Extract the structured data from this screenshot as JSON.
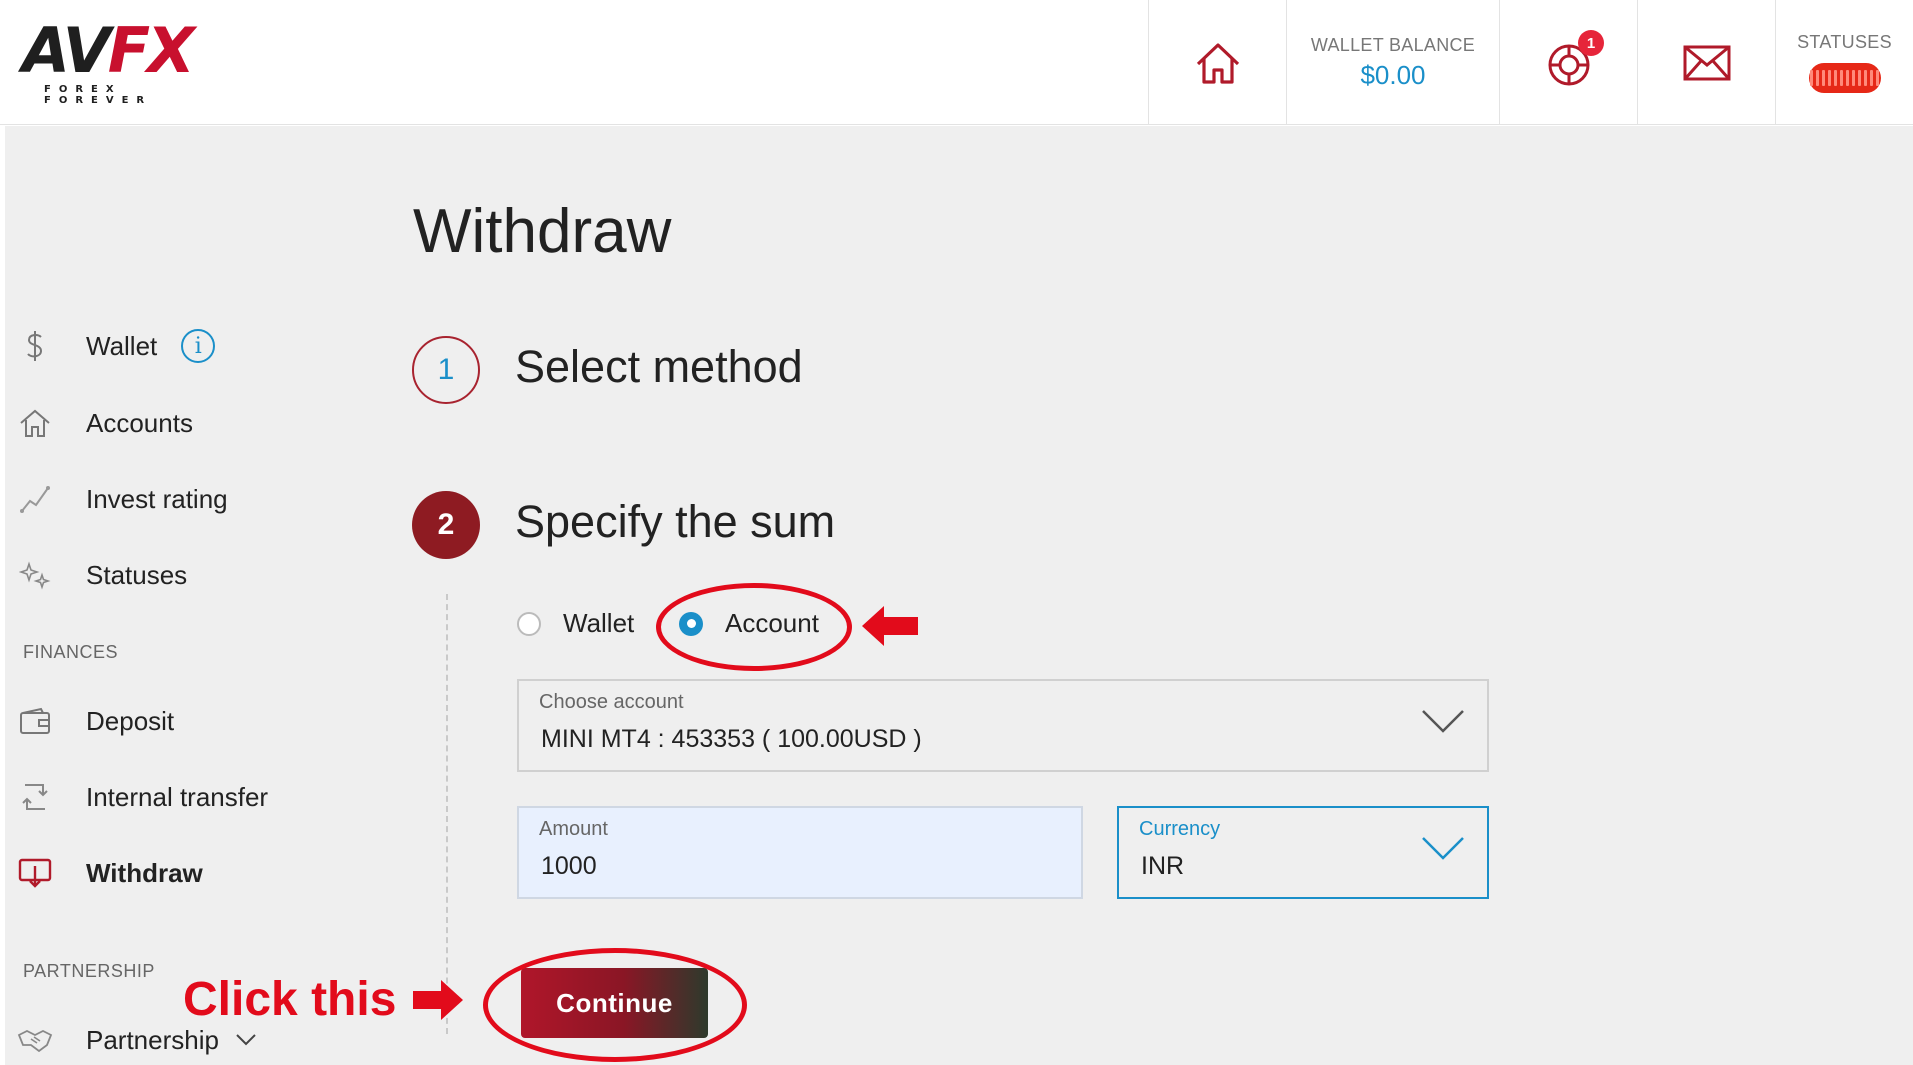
{
  "header": {
    "logo_text_a": "AV",
    "logo_text_b": "FX",
    "logo_tagline": "FOREX FOREVER",
    "wallet_balance_label": "WALLET BALANCE",
    "wallet_balance_value": "$0.00",
    "notification_count": "1",
    "statuses_label": "STATUSES"
  },
  "sidebar": {
    "items": [
      {
        "label": "Wallet",
        "icon": "dollar-icon"
      },
      {
        "label": "Accounts",
        "icon": "home-icon"
      },
      {
        "label": "Invest rating",
        "icon": "chart-line-icon"
      },
      {
        "label": "Statuses",
        "icon": "sparkle-icon"
      }
    ],
    "finances_heading": "FINANCES",
    "finances_items": [
      {
        "label": "Deposit",
        "icon": "wallet-icon"
      },
      {
        "label": "Internal transfer",
        "icon": "transfer-icon"
      },
      {
        "label": "Withdraw",
        "icon": "withdraw-icon",
        "active": true
      }
    ],
    "partnership_heading": "PARTNERSHIP",
    "partnership_item": {
      "label": "Partnership",
      "icon": "handshake-icon"
    }
  },
  "main": {
    "title": "Withdraw",
    "step1": {
      "number": "1",
      "title": "Select method"
    },
    "step2": {
      "number": "2",
      "title": "Specify the sum"
    },
    "source_options": [
      {
        "label": "Wallet",
        "selected": false
      },
      {
        "label": "Account",
        "selected": true
      }
    ],
    "choose_account": {
      "label": "Choose account",
      "value": "MINI MT4 : 453353 ( 100.00USD )"
    },
    "amount": {
      "label": "Amount",
      "value": "1000"
    },
    "currency": {
      "label": "Currency",
      "value": "INR"
    },
    "continue_label": "Continue"
  },
  "annotations": {
    "click_this": "Click this"
  },
  "colors": {
    "accent_blue": "#1a8fc9",
    "brand_red": "#c8102e",
    "annotation_red": "#e20b1b"
  }
}
